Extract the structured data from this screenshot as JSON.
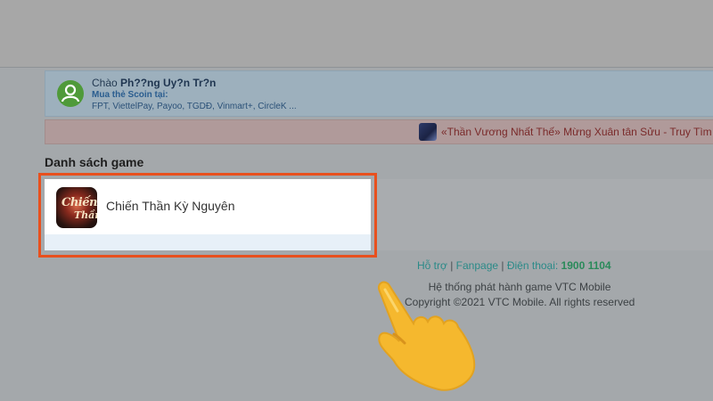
{
  "welcome": {
    "greeting_prefix": "Chào",
    "user_name": "Ph??ng Uy?n Tr?n",
    "buy_label": "Mua thẻ Scoin tại:",
    "stores": "FPT, ViettelPay, Payoo, TGDĐ, Vinmart+, CircleK ..."
  },
  "news": {
    "text": "«Thần Vương Nhất Thế» Mừng Xuân tân Sửu - Truy Tìm Tiểu Sửu"
  },
  "games": {
    "section_title": "Danh sách game",
    "items": [
      {
        "name": "Chiến Thần Kỳ Nguyên",
        "icon_text_1": "Chiến",
        "icon_text_2": "Thần"
      }
    ]
  },
  "footer": {
    "support": "Hỗ trợ",
    "sep1": " | ",
    "fanpage": "Fanpage",
    "sep2": " | ",
    "phone_label": "Điện thoại: ",
    "phone": "1900 1104",
    "line1": "Hệ thống phát hành game VTC Mobile",
    "line2": "Copyright ©2021 VTC Mobile. All rights reserved"
  },
  "colors": {
    "highlight": "#e8501e",
    "hand": "#f5b82e",
    "avatar": "#4f9a3a"
  }
}
